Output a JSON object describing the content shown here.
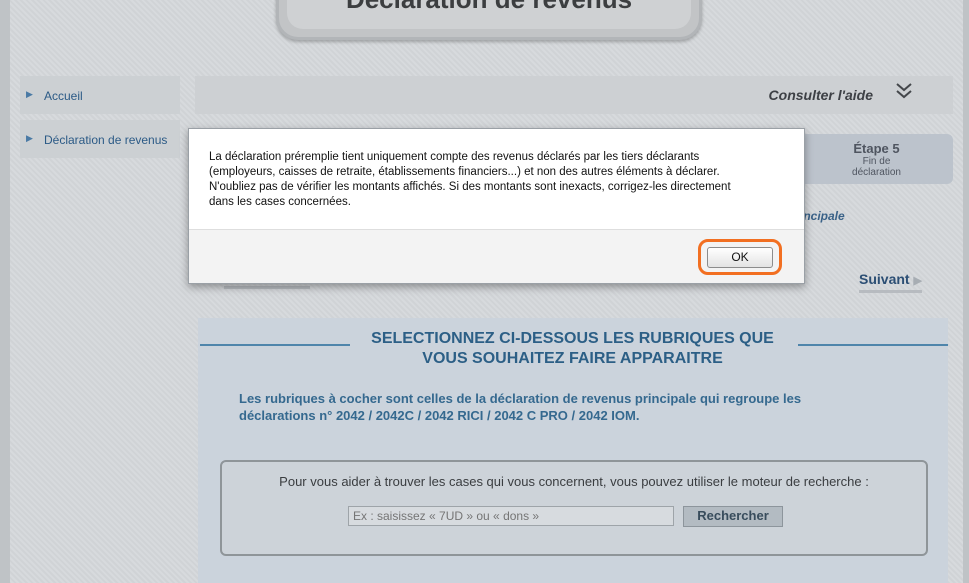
{
  "header": {
    "title": "Déclaration de revenus"
  },
  "sidebar": {
    "items": [
      {
        "label": "Accueil"
      },
      {
        "label": "Déclaration de revenus"
      }
    ]
  },
  "helpbar": {
    "label": "Consulter l'aide"
  },
  "steps": {
    "current": {
      "title": "Étape 5",
      "line1": "Fin de",
      "line2": "déclaration"
    }
  },
  "subtitle_fragment": "incipale",
  "navigation": {
    "next_label": "Suivant"
  },
  "content": {
    "title_line1": "SELECTIONNEZ CI-DESSOUS LES RUBRIQUES QUE",
    "title_line2": "VOUS SOUHAITEZ FAIRE APPARAITRE",
    "info_line1": "Les rubriques à cocher sont celles de la déclaration de revenus principale qui regroupe les",
    "info_line2": "déclarations n° 2042 / 2042C / 2042 RICI / 2042 C PRO / 2042 IOM.",
    "search_help": "Pour vous aider à trouver les cases qui vous concernent, vous pouvez utiliser le moteur de recherche :",
    "search_placeholder": "Ex : saisissez « 7UD » ou « dons »",
    "search_button": "Rechercher"
  },
  "modal": {
    "line1": "La déclaration préremplie tient uniquement compte des revenus déclarés par les tiers déclarants",
    "line2": "(employeurs, caisses de retraite, établissements financiers...) et non des autres éléments à déclarer.",
    "line3": "N'oubliez pas de vérifier les montants affichés. Si des montants sont inexacts, corrigez-les directement",
    "line4": "dans les cases concernées.",
    "ok_label": "OK"
  },
  "colors": {
    "highlight": "#f26f21",
    "accent": "#2c5f86"
  }
}
